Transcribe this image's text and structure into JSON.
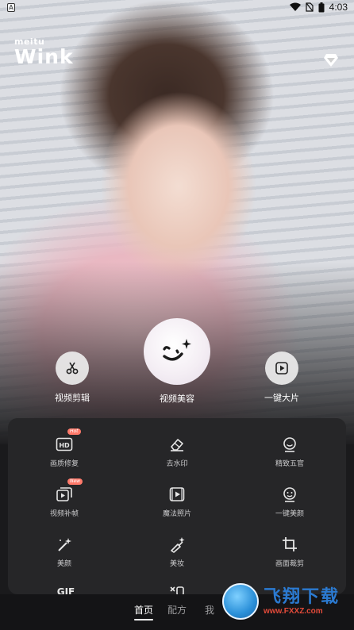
{
  "status": {
    "left_badge": "A",
    "time": "4:03"
  },
  "brand": {
    "small": "meitu",
    "name": "Wink"
  },
  "quick_actions": [
    {
      "label": "视频剪辑",
      "icon": "scissors-icon"
    },
    {
      "label": "视频美容",
      "icon": "smile-sparkle-icon"
    },
    {
      "label": "一键大片",
      "icon": "play-icon"
    }
  ],
  "tools": [
    {
      "label": "画质修复",
      "icon": "hd-icon",
      "badge": "Hot"
    },
    {
      "label": "去水印",
      "icon": "eraser-icon"
    },
    {
      "label": "精致五官",
      "icon": "face-icon"
    },
    {
      "label": "视频补帧",
      "icon": "frames-icon",
      "badge": "New"
    },
    {
      "label": "魔法照片",
      "icon": "magic-photo-icon"
    },
    {
      "label": "一键美颜",
      "icon": "beauty-face-icon"
    },
    {
      "label": "美颜",
      "icon": "magic-wand-icon"
    },
    {
      "label": "美妆",
      "icon": "makeup-brush-icon"
    },
    {
      "label": "画面裁剪",
      "icon": "crop-icon"
    },
    {
      "label": "GIF",
      "icon": "gif-icon"
    }
  ],
  "nav": {
    "tabs": [
      "首页",
      "配方",
      "我"
    ],
    "active": "首页"
  },
  "watermark": {
    "title": "飞翔下载",
    "url": "www.FXXZ.com"
  }
}
